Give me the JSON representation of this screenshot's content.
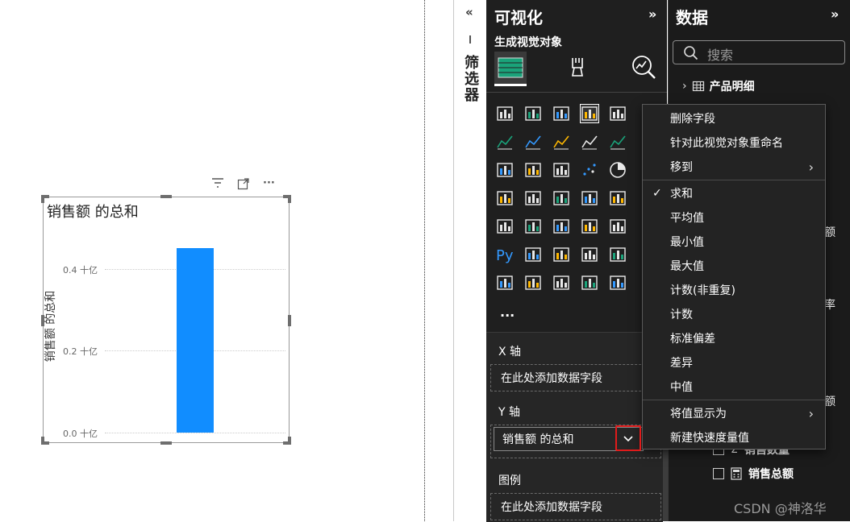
{
  "canvas": {
    "visual_title": "销售额 的总和",
    "y_axis_title": "销售额 的总和",
    "y_ticks": [
      "0.4 十亿",
      "0.2 十亿",
      "0.0 十亿"
    ],
    "bar_color": "#118DFF",
    "toolbar": {
      "filter_icon": "filter-icon",
      "focus_icon": "focus-mode-icon",
      "more_label": "···"
    }
  },
  "chart_data": {
    "type": "bar",
    "categories": [
      ""
    ],
    "values": [
      0.45
    ],
    "title": "销售额 的总和",
    "xlabel": "",
    "ylabel": "销售额 的总和",
    "ylim": [
      0,
      0.5
    ],
    "unit": "十亿",
    "grid": true
  },
  "filter_pane": {
    "collapse_label": "«",
    "label": "筛选器"
  },
  "viz_pane": {
    "title": "可视化",
    "expand_label": "»",
    "section_label": "生成视觉对象",
    "more_visuals": "...",
    "wells": [
      {
        "label": "X 轴",
        "placeholder": "在此处添加数据字段"
      },
      {
        "label": "Y 轴",
        "field": "销售额 的总和",
        "dropdown_icon": "chevron-down-icon"
      },
      {
        "label": "图例",
        "placeholder": "在此处添加数据字段"
      }
    ]
  },
  "data_pane": {
    "title": "数据",
    "expand_label": "»",
    "search_placeholder": "搜索",
    "table_name": "产品明细",
    "partial_labels": [
      "额",
      "率",
      "额"
    ],
    "fields": [
      {
        "label": "销售数量",
        "icon": "sigma-icon"
      },
      {
        "label": "销售总额",
        "icon": "calculator-icon"
      }
    ]
  },
  "context_menu": {
    "group1": [
      "删除字段",
      "针对此视觉对象重命名",
      "移到"
    ],
    "aggregations": [
      "求和",
      "平均值",
      "最小值",
      "最大值",
      "计数(非重复)",
      "计数",
      "标准偏差",
      "差异",
      "中值"
    ],
    "checked": "求和",
    "group3": [
      "将值显示为",
      "新建快速度量值"
    ]
  },
  "watermark": "CSDN @神洛华"
}
